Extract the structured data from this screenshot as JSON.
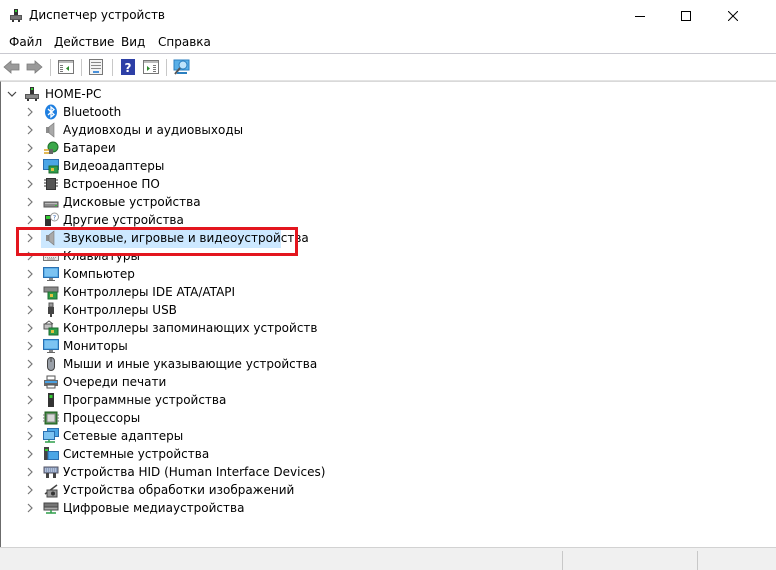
{
  "window": {
    "title": "Диспетчер устройств",
    "icon": "device-manager-icon",
    "controls": [
      "minimize-icon",
      "maximize-icon",
      "close-icon"
    ]
  },
  "menu": {
    "items": [
      {
        "label": "Файл"
      },
      {
        "label": "Действие"
      },
      {
        "label": "Вид"
      },
      {
        "label": "Справка"
      }
    ]
  },
  "toolbar": {
    "buttons": [
      "back-arrow-icon",
      "forward-arrow-icon",
      "show-hide-console-tree-icon",
      "properties-icon",
      "help-icon",
      "action-pane-icon",
      "scan-hardware-icon"
    ]
  },
  "tree": {
    "root": {
      "label": "HOME-PC",
      "expanded": true,
      "icon": "computer-icon"
    },
    "items": [
      {
        "label": "Bluetooth",
        "icon": "bluetooth-icon"
      },
      {
        "label": "Аудиовходы и аудиовыходы",
        "icon": "speaker-icon"
      },
      {
        "label": "Батареи",
        "icon": "battery-icon"
      },
      {
        "label": "Видеоадаптеры",
        "icon": "display-adapter-icon"
      },
      {
        "label": "Встроенное ПО",
        "icon": "firmware-chip-icon"
      },
      {
        "label": "Дисковые устройства",
        "icon": "disk-drive-icon"
      },
      {
        "label": "Другие устройства",
        "icon": "unknown-device-icon"
      },
      {
        "label": "Звуковые, игровые и видеоустройства",
        "icon": "sound-icon",
        "selected": true,
        "highlighted_box": true
      },
      {
        "label": "Клавиатуры",
        "icon": "keyboard-icon"
      },
      {
        "label": "Компьютер",
        "icon": "monitor-icon"
      },
      {
        "label": "Контроллеры IDE ATA/ATAPI",
        "icon": "ide-controller-icon"
      },
      {
        "label": "Контроллеры USB",
        "icon": "usb-icon"
      },
      {
        "label": "Контроллеры запоминающих устройств",
        "icon": "storage-controller-icon"
      },
      {
        "label": "Мониторы",
        "icon": "monitor-icon"
      },
      {
        "label": "Мыши и иные указывающие устройства",
        "icon": "mouse-icon"
      },
      {
        "label": "Очереди печати",
        "icon": "printer-icon"
      },
      {
        "label": "Программные устройства",
        "icon": "software-device-icon"
      },
      {
        "label": "Процессоры",
        "icon": "processor-icon"
      },
      {
        "label": "Сетевые адаптеры",
        "icon": "network-adapter-icon"
      },
      {
        "label": "Системные устройства",
        "icon": "system-devices-icon"
      },
      {
        "label": "Устройства HID (Human Interface Devices)",
        "icon": "hid-icon"
      },
      {
        "label": "Устройства обработки изображений",
        "icon": "camera-icon"
      },
      {
        "label": "Цифровые медиаустройства",
        "icon": "media-device-icon"
      }
    ]
  },
  "colors": {
    "selection": "#cce8ff",
    "annotation_box": "#e3161e"
  }
}
